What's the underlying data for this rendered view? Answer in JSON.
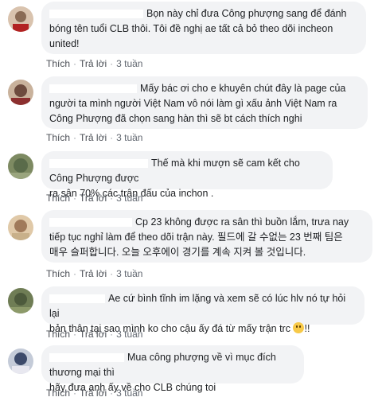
{
  "comments": [
    {
      "text_lines": [
        "Bọn này chỉ đưa Công phượng sang để đánh",
        "bóng tên tuổi CLB thôi. Tôi đề nghị ae tất cả bỏ theo dõi incheon",
        "united!"
      ],
      "like": "Thích",
      "reply": "Trả lời",
      "time": "3 tuần",
      "avatar_color": "#8a6b55"
    },
    {
      "text_lines": [
        "Mấy bác ơi cho e khuyên chút đây là page của",
        "người ta mình người Việt Nam vô nói làm gì xấu ảnh Việt Nam ra",
        "Công Phượng đã chọn sang hàn thì sẽ bt cách thích nghi"
      ],
      "like": "Thích",
      "reply": "Trả lời",
      "time": "3 tuần",
      "avatar_color": "#6d4b3e"
    },
    {
      "text_lines": [
        "Thế mà khi mượn sẽ cam kết cho Công Phượng được",
        "ra sân 70% các trận đấu của inchon ."
      ],
      "like": "Thích",
      "reply": "Trả lời",
      "time": "3 tuần",
      "avatar_color": "#5a6b4a"
    },
    {
      "text_lines": [
        "Cp 23 không được ra sân thì buồn lắm, trưa nay",
        "tiếp tục nghỉ làm để theo dõi trận này. 필드에 갈 수없는 23 번째 팀은",
        "매우 슬퍼합니다. 오늘 오후에이 경기를 계속 지켜 볼 것입니다."
      ],
      "like": "Thích",
      "reply": "Trả lời",
      "time": "3 tuần",
      "avatar_color": "#a07a5a"
    },
    {
      "text_lines": [
        "Ae cứ bình tĩnh im lặng và xem sẽ có lúc hlv nó tự hỏi lại",
        "bản thân tại sao mình ko cho cậu ấy đá từ mấy trận trc",
        "!!"
      ],
      "like": "Thích",
      "reply": "Trả lời",
      "time": "3 tuần",
      "avatar_color": "#4d5a3c"
    },
    {
      "text_lines": [
        "Mua công phượng về vì mục đích thương mại thì",
        "hãy đưa anh ấy về cho CLB chúng toi"
      ],
      "like": "Thích",
      "reply": "Trả lời",
      "time": "3 tuần",
      "avatar_color": "#3c4a6a"
    }
  ]
}
